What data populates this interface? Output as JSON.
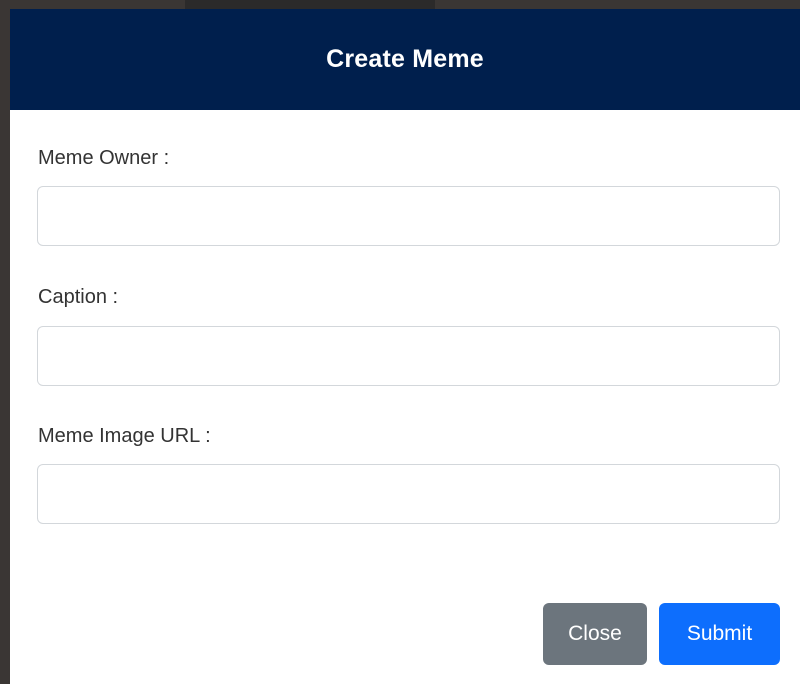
{
  "modal": {
    "title": "Create Meme",
    "fields": [
      {
        "label": "Meme Owner :",
        "value": "",
        "placeholder": ""
      },
      {
        "label": "Caption :",
        "value": "",
        "placeholder": ""
      },
      {
        "label": "Meme Image URL :",
        "value": "",
        "placeholder": ""
      }
    ],
    "buttons": {
      "close_label": "Close",
      "submit_label": "Submit"
    }
  },
  "colors": {
    "header_bg": "#001f4d",
    "close_button": "#6c757d",
    "submit_button": "#0d6efd"
  }
}
